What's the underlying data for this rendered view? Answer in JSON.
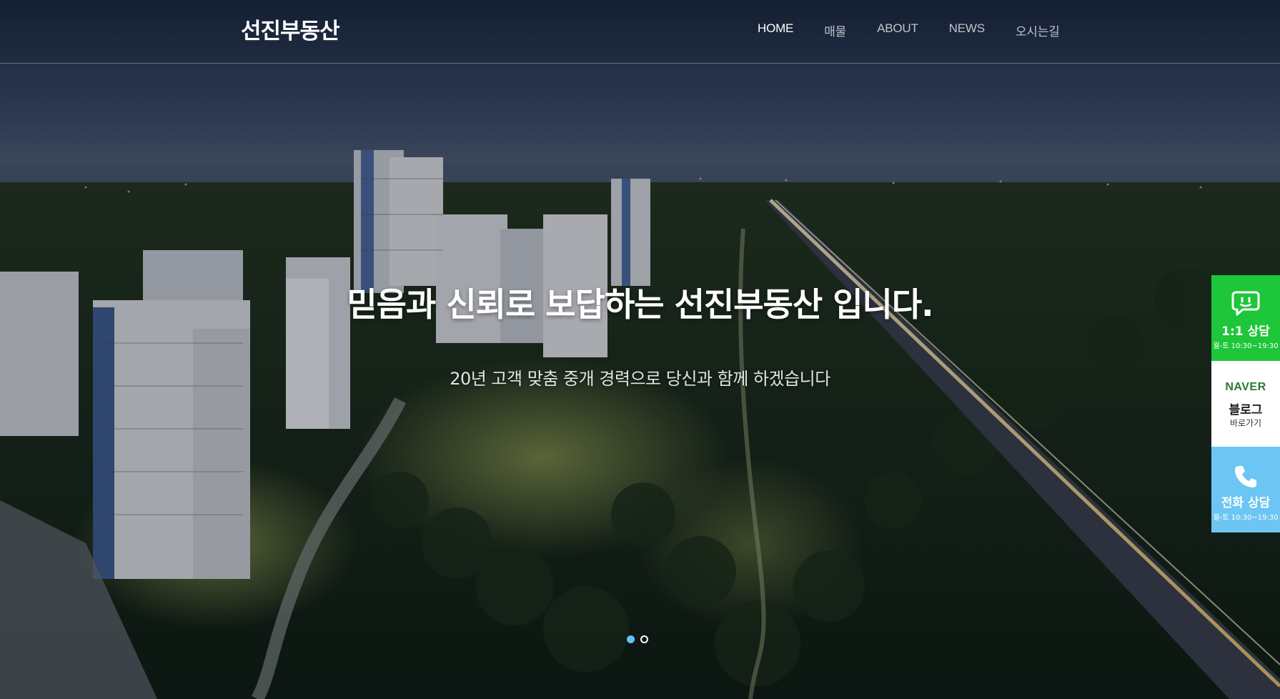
{
  "header": {
    "logo": "선진부동산",
    "nav": [
      "HOME",
      "매물",
      "ABOUT",
      "NEWS",
      "오시는길"
    ],
    "active_nav": "HOME"
  },
  "hero": {
    "headline": "믿음과 신뢰로 보답하는 선진부동산 입니다.",
    "subline": "20년 고객 맞춤 중개 경력으로 당신과 함께 하겠습니다",
    "slides": 2,
    "active_slide": 1
  },
  "quick_menu": {
    "chat": {
      "label": "1:1 상담",
      "hours": "월-토 10:30~19:30",
      "icon": "chat-bubble-icon",
      "color": "#1ec63a"
    },
    "blog": {
      "brand": "NAVER",
      "label": "블로그",
      "sub": "바로가기",
      "color": "#ffffff"
    },
    "phone": {
      "label": "전화 상담",
      "hours": "월-토 10:30~19:30",
      "icon": "phone-icon",
      "color": "#6cc5f3"
    }
  },
  "colors": {
    "accent": "#5ec5f5"
  }
}
